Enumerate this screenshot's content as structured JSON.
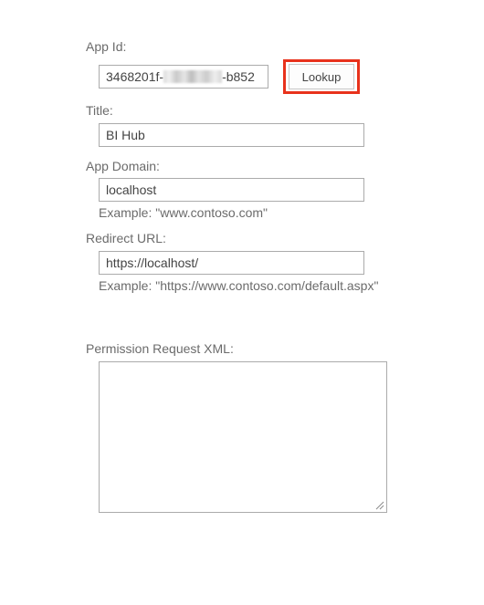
{
  "app_id": {
    "label": "App Id:",
    "value_prefix": "3468201f-",
    "value_suffix": "-b852",
    "lookup_label": "Lookup"
  },
  "title": {
    "label": "Title:",
    "value": "BI Hub"
  },
  "app_domain": {
    "label": "App Domain:",
    "value": "localhost",
    "example": "Example: \"www.contoso.com\""
  },
  "redirect_url": {
    "label": "Redirect URL:",
    "value": "https://localhost/",
    "example": "Example: \"https://www.contoso.com/default.aspx\""
  },
  "permission_xml": {
    "label": "Permission Request XML:",
    "value": ""
  },
  "colors": {
    "highlight": "#e8321c",
    "label_text": "#6b6b6b",
    "field_border": "#ababab"
  }
}
